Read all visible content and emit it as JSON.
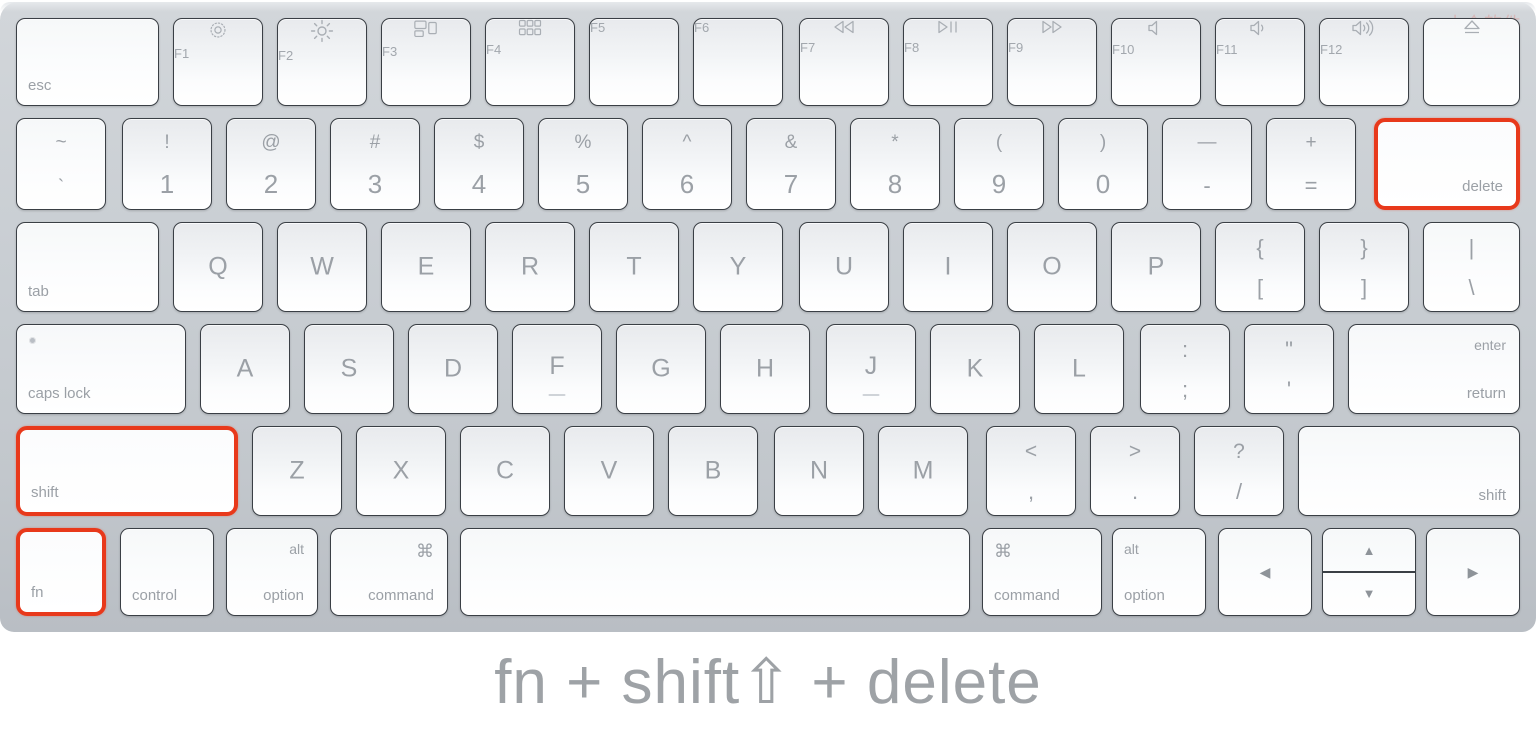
{
  "caption": "fn + shift⇧ + delete",
  "watermark": "小众软件",
  "colors": {
    "highlight": "#e8391b",
    "key_label": "#9ba0a6",
    "caption": "#9ea2a6",
    "body": "#c9ced3"
  },
  "highlighted_keys": [
    "delete",
    "shift-left",
    "fn"
  ],
  "rows": {
    "function_row": [
      {
        "id": "esc",
        "label": "esc",
        "align": "bottom-left"
      },
      {
        "id": "f1",
        "icon": "brightness-down-icon",
        "sub": "F1"
      },
      {
        "id": "f2",
        "icon": "brightness-up-icon",
        "sub": "F2"
      },
      {
        "id": "f3",
        "icon": "mission-control-icon",
        "sub": "F3"
      },
      {
        "id": "f4",
        "icon": "launchpad-icon",
        "sub": "F4"
      },
      {
        "id": "f5",
        "icon": "none",
        "sub": "F5"
      },
      {
        "id": "f6",
        "icon": "none",
        "sub": "F6"
      },
      {
        "id": "f7",
        "icon": "rewind-icon",
        "sub": "F7"
      },
      {
        "id": "f8",
        "icon": "play-pause-icon",
        "sub": "F8"
      },
      {
        "id": "f9",
        "icon": "fast-forward-icon",
        "sub": "F9"
      },
      {
        "id": "f10",
        "icon": "volume-mute-icon",
        "sub": "F10"
      },
      {
        "id": "f11",
        "icon": "volume-down-icon",
        "sub": "F11"
      },
      {
        "id": "f12",
        "icon": "volume-up-icon",
        "sub": "F12"
      },
      {
        "id": "eject",
        "icon": "eject-icon",
        "sub": ""
      }
    ],
    "number_row": [
      {
        "id": "backtick",
        "top": "~",
        "bottom": "`"
      },
      {
        "id": "1",
        "top": "!",
        "bottom": "1"
      },
      {
        "id": "2",
        "top": "@",
        "bottom": "2"
      },
      {
        "id": "3",
        "top": "#",
        "bottom": "3"
      },
      {
        "id": "4",
        "top": "$",
        "bottom": "4"
      },
      {
        "id": "5",
        "top": "%",
        "bottom": "5"
      },
      {
        "id": "6",
        "top": "^",
        "bottom": "6"
      },
      {
        "id": "7",
        "top": "&",
        "bottom": "7"
      },
      {
        "id": "8",
        "top": "*",
        "bottom": "8"
      },
      {
        "id": "9",
        "top": "(",
        "bottom": "9"
      },
      {
        "id": "0",
        "top": ")",
        "bottom": "0"
      },
      {
        "id": "minus",
        "top": "—",
        "bottom": "-"
      },
      {
        "id": "equal",
        "top": "+",
        "bottom": "="
      },
      {
        "id": "delete",
        "label": "delete",
        "align": "bottom-right",
        "highlight": true
      }
    ],
    "qwerty_row": [
      {
        "id": "tab",
        "label": "tab",
        "align": "bottom-left"
      },
      {
        "id": "q",
        "label": "Q"
      },
      {
        "id": "w",
        "label": "W"
      },
      {
        "id": "e",
        "label": "E"
      },
      {
        "id": "r",
        "label": "R"
      },
      {
        "id": "t",
        "label": "T"
      },
      {
        "id": "y",
        "label": "Y"
      },
      {
        "id": "u",
        "label": "U"
      },
      {
        "id": "i",
        "label": "I"
      },
      {
        "id": "o",
        "label": "O"
      },
      {
        "id": "p",
        "label": "P"
      },
      {
        "id": "bracket-left",
        "top": "{",
        "bottom": "["
      },
      {
        "id": "bracket-right",
        "top": "}",
        "bottom": "]"
      },
      {
        "id": "backslash",
        "top": "|",
        "bottom": "\\"
      }
    ],
    "home_row": [
      {
        "id": "caps-lock",
        "label": "caps lock",
        "align": "bottom-left",
        "led": true
      },
      {
        "id": "a",
        "label": "A"
      },
      {
        "id": "s",
        "label": "S"
      },
      {
        "id": "d",
        "label": "D"
      },
      {
        "id": "f",
        "label": "F",
        "bump": true
      },
      {
        "id": "g",
        "label": "G"
      },
      {
        "id": "h",
        "label": "H"
      },
      {
        "id": "j",
        "label": "J",
        "bump": true
      },
      {
        "id": "k",
        "label": "K"
      },
      {
        "id": "l",
        "label": "L"
      },
      {
        "id": "semicolon",
        "top": ":",
        "bottom": ";"
      },
      {
        "id": "quote",
        "top": "\"",
        "bottom": "'"
      },
      {
        "id": "return",
        "label_top": "enter",
        "label_bottom": "return"
      }
    ],
    "shift_row": [
      {
        "id": "shift-left",
        "label": "shift",
        "align": "bottom-left",
        "highlight": true
      },
      {
        "id": "z",
        "label": "Z"
      },
      {
        "id": "x",
        "label": "X"
      },
      {
        "id": "c",
        "label": "C"
      },
      {
        "id": "v",
        "label": "V"
      },
      {
        "id": "b",
        "label": "B"
      },
      {
        "id": "n",
        "label": "N"
      },
      {
        "id": "m",
        "label": "M"
      },
      {
        "id": "comma",
        "top": "<",
        "bottom": ","
      },
      {
        "id": "period",
        "top": ">",
        "bottom": "."
      },
      {
        "id": "slash",
        "top": "?",
        "bottom": "/"
      },
      {
        "id": "shift-right",
        "label": "shift",
        "align": "bottom-right"
      }
    ],
    "bottom_row": [
      {
        "id": "fn",
        "label": "fn",
        "align": "bottom-left",
        "highlight": true
      },
      {
        "id": "control",
        "label": "control",
        "align": "bottom-left"
      },
      {
        "id": "option-left",
        "label_top": "alt",
        "label_bottom": "option",
        "align": "right"
      },
      {
        "id": "command-left",
        "label_top": "⌘",
        "label_bottom": "command",
        "align": "right"
      },
      {
        "id": "space",
        "label": ""
      },
      {
        "id": "command-right",
        "label_top": "⌘",
        "label_bottom": "command",
        "align": "left"
      },
      {
        "id": "option-right",
        "label_top": "alt",
        "label_bottom": "option",
        "align": "left"
      },
      {
        "id": "arrow-left",
        "label": "◀"
      },
      {
        "id": "arrow-up",
        "label": "▲"
      },
      {
        "id": "arrow-down",
        "label": "▼"
      },
      {
        "id": "arrow-right",
        "label": "▶"
      }
    ]
  }
}
